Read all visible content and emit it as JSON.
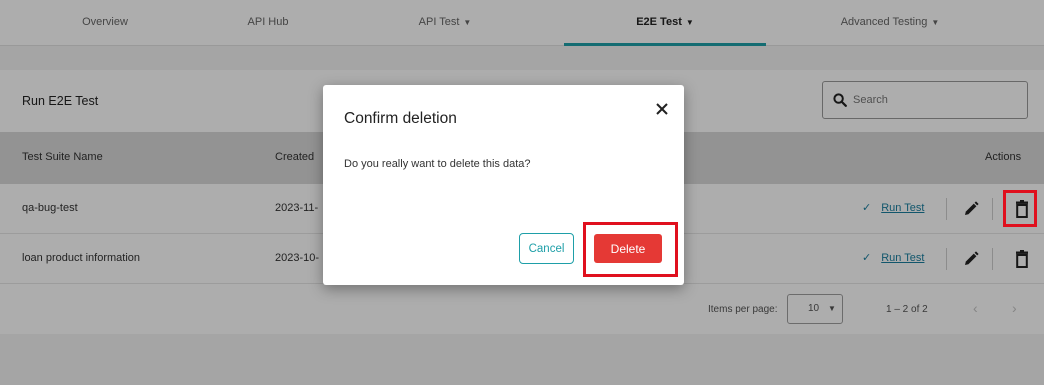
{
  "nav": {
    "tabs": [
      {
        "label": "Overview"
      },
      {
        "label": "API Hub"
      },
      {
        "label": "API Test",
        "caret": "▼"
      },
      {
        "label": "E2E Test",
        "caret": "▼",
        "active": true
      },
      {
        "label": "Advanced Testing",
        "caret": "▼"
      }
    ]
  },
  "card": {
    "title": "Run E2E Test",
    "search_placeholder": "Search"
  },
  "table": {
    "headers": {
      "name": "Test Suite Name",
      "created": "Created",
      "actions": "Actions"
    },
    "rows": [
      {
        "name": "qa-bug-test",
        "created": "2023-11-",
        "run_label": "Run Test"
      },
      {
        "name": "loan product information",
        "created": "2023-10-",
        "run_label": "Run Test"
      }
    ]
  },
  "paginator": {
    "items_per_page_label": "Items per page:",
    "page_size": "10",
    "range": "1 – 2 of 2"
  },
  "dialog": {
    "title": "Confirm deletion",
    "message": "Do you really want to delete this data?",
    "cancel_label": "Cancel",
    "delete_label": "Delete"
  },
  "colors": {
    "accent": "#1e9fa8",
    "danger": "#e53935",
    "highlight": "#e0101e",
    "link": "#1a7fa0"
  },
  "icons": [
    "caret-down-icon",
    "search-icon",
    "check-icon",
    "pencil-icon",
    "trash-icon",
    "close-icon",
    "chevron-left-icon",
    "chevron-right-icon"
  ]
}
